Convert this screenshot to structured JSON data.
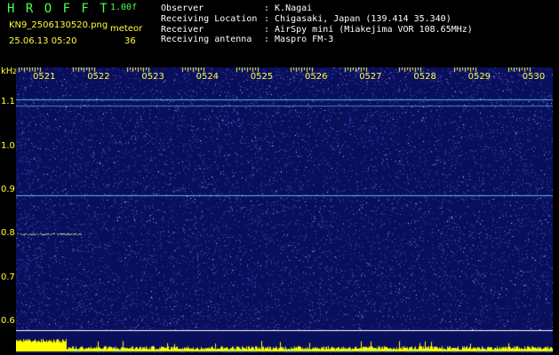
{
  "header": {
    "logo": "H R O F F T",
    "version": "1.00f",
    "filename": "KN9_2506130520.png",
    "datetime": "25.06.13 05:20",
    "meteor_label": "meteor",
    "meteor_count": "36",
    "labels": [
      "Observer",
      "Receiving Location",
      "Receiver",
      "Receiving antenna"
    ],
    "values": [
      ": K.Nagai",
      ": Chigasaki, Japan (139.414 35.340)",
      ": AirSpy mini (Miakejima VOR 108.65MHz)",
      ": Maspro FM-3"
    ]
  },
  "chart_data": {
    "type": "heatmap",
    "ylabel": "kHz",
    "x_ticks": [
      "0521",
      "0522",
      "0523",
      "0524",
      "0525",
      "0526",
      "0527",
      "0528",
      "0529",
      "0530"
    ],
    "y_ticks": [
      "1.1",
      "1.0",
      "0.9",
      "0.8",
      "0.7",
      "0.6"
    ],
    "ylim": [
      0.58,
      1.18
    ],
    "steady_lines_khz": [
      1.108,
      1.092,
      0.888
    ],
    "meteor_trace": {
      "freq_khz": 0.8,
      "time_start": "0521",
      "time_end": "0522"
    },
    "colors": {
      "background": "#0a0f5c",
      "noise": "#3c4cc8",
      "line": "#60d8ff",
      "meteor": "#a0ffa0",
      "power": "#ffff00"
    }
  }
}
